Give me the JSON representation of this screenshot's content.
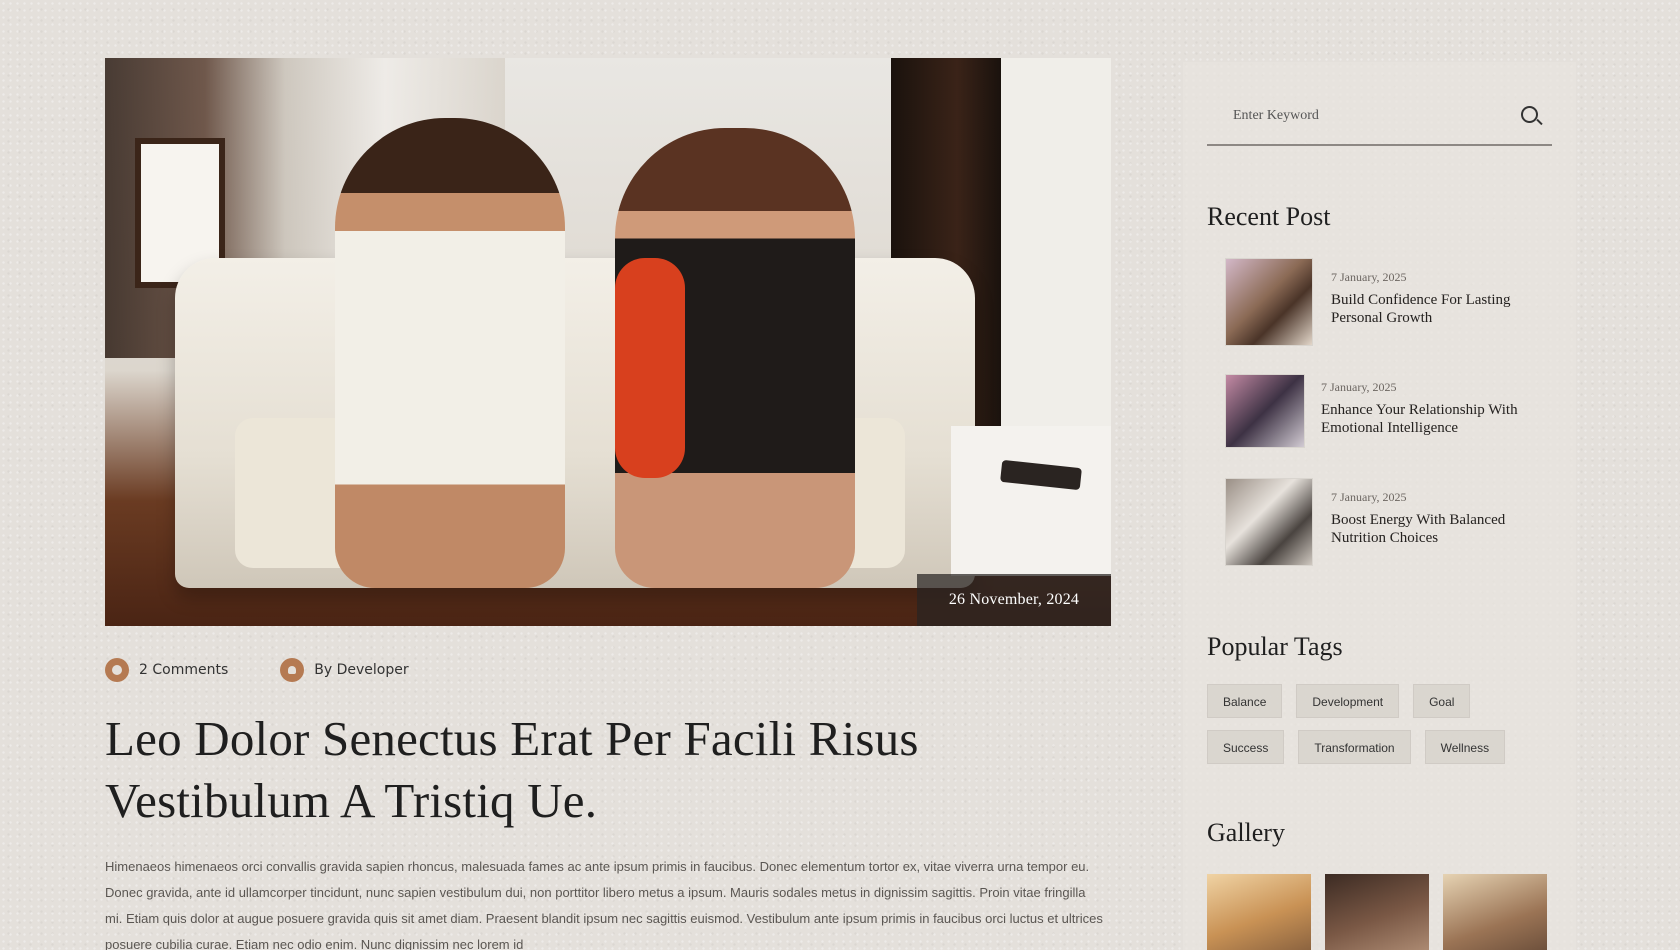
{
  "post": {
    "date_badge": "26 November, 2024",
    "comments": "2 Comments",
    "author": "By Developer",
    "title": "Leo Dolor Senectus Erat Per Facili Risus Vestibulum A Tristiq Ue.",
    "body": "Himenaeos himenaeos orci convallis gravida sapien rhoncus, malesuada fames ac ante ipsum primis in faucibus. Donec elementum tortor ex, vitae viverra urna tempor eu. Donec gravida, ante id ullamcorper tincidunt, nunc sapien vestibulum dui, non porttitor libero metus a ipsum. Mauris sodales metus in dignissim sagittis. Proin vitae fringilla mi. Etiam quis dolor at augue posuere gravida quis sit amet diam. Praesent blandit ipsum nec sagittis euismod. Vestibulum ante ipsum primis in faucibus orci luctus et ultrices posuere cubilia curae. Etiam nec odio enim. Nunc dignissim nec lorem id"
  },
  "sidebar": {
    "search": {
      "placeholder": "Enter Keyword"
    },
    "recent_heading": "Recent Post",
    "recent_posts": [
      {
        "date": "7 January, 2025",
        "title": "Build Confidence For Lasting Personal Growth"
      },
      {
        "date": "7 January, 2025",
        "title": "Enhance Your Relationship With Emotional Intelligence"
      },
      {
        "date": "7 January, 2025",
        "title": "Boost Energy With Balanced Nutrition Choices"
      }
    ],
    "tags_heading": "Popular Tags",
    "tags": [
      "Balance",
      "Development",
      "Goal",
      "Success",
      "Transformation",
      "Wellness"
    ],
    "gallery_heading": "Gallery"
  },
  "colors": {
    "accent": "#b57a52",
    "background": "#e4e0db"
  }
}
